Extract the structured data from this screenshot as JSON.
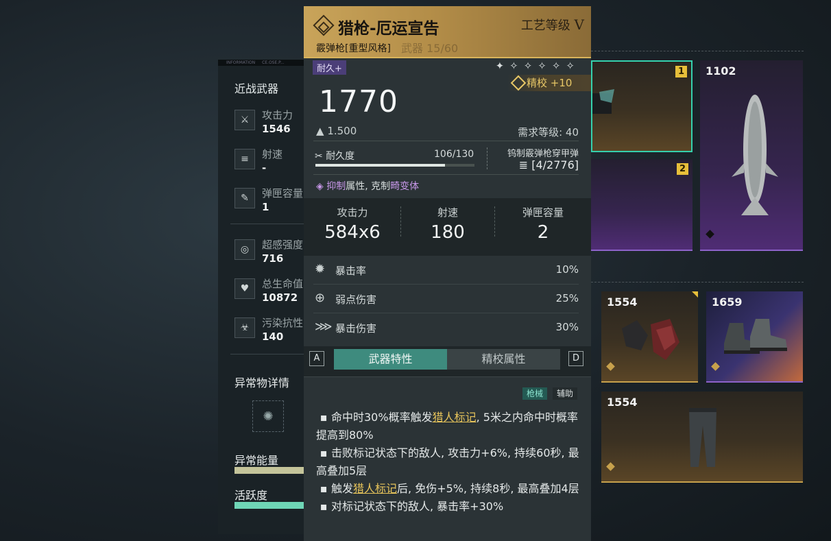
{
  "left_panel": {
    "header_tabs": [
      "INFORMATION",
      "CE.OSE.P..."
    ],
    "section_title": "近战武器",
    "stats": [
      {
        "label": "攻击力",
        "value": "1546",
        "icon": "sword-icon"
      },
      {
        "label": "射速",
        "value": "-",
        "icon": "speed-icon"
      },
      {
        "label": "弹匣容量",
        "value": "1",
        "icon": "magazine-icon"
      },
      {
        "label": "超感强度",
        "value": "716",
        "icon": "psi-icon"
      },
      {
        "label": "总生命值",
        "value": "10872",
        "icon": "heart-icon"
      },
      {
        "label": "污染抗性",
        "value": "140",
        "icon": "biohazard-icon"
      }
    ],
    "anomaly_title": "异常物详情",
    "energy_label": "异常能量",
    "activity_label": "活跃度",
    "energy_color": "#c4c49a",
    "activity_color": "#6fd6b6"
  },
  "inventory": {
    "slots": [
      {
        "number": "",
        "badge": "1",
        "rarity": "gold",
        "selected": true
      },
      {
        "number": "1102",
        "item": "fish",
        "rarity": "purple"
      },
      {
        "number": "",
        "badge": "2",
        "rarity": "purple"
      },
      {
        "number": "1554",
        "item": "gloves",
        "rarity": "gold"
      },
      {
        "number": "1659",
        "item": "boots",
        "rarity": "purple"
      },
      {
        "number": "1554",
        "item": "pants",
        "rarity": "gold"
      }
    ]
  },
  "tooltip": {
    "title": "猎枪-厄运宣告",
    "craft_label": "工艺等级",
    "craft_level": "V",
    "weapon_type": "霰弹枪[重型风格]",
    "type_ghost": "武器 15/60",
    "durable_tag": "耐久+",
    "stars": "✦✧✧✧✧✧",
    "refine": "精校 +10",
    "power": "1770",
    "weight": "1.500",
    "requirement": "需求等级: 40",
    "durability_label": "耐久度",
    "durability_value": "106/130",
    "durability_fraction": 0.815,
    "ammo_label": "钨制霰弹枪穿甲弹",
    "ammo_value": "[4/2776]",
    "trait_prefix": "抑制",
    "trait_mid": "属性, 克制",
    "trait_suffix": "畸变体",
    "stats3": [
      {
        "label": "攻击力",
        "value": "584x6"
      },
      {
        "label": "射速",
        "value": "180"
      },
      {
        "label": "弹匣容量",
        "value": "2"
      }
    ],
    "crit": [
      {
        "label": "暴击率",
        "value": "10%",
        "icon": "burst-icon"
      },
      {
        "label": "弱点伤害",
        "value": "25%",
        "icon": "target-icon"
      },
      {
        "label": "暴击伤害",
        "value": "30%",
        "icon": "claw-icon"
      }
    ],
    "key_left": "A",
    "key_right": "D",
    "tab_active": "武器特性",
    "tab_inactive": "精校属性",
    "chip_1": "枪械",
    "chip_2": "辅助",
    "desc": [
      {
        "pre": "命中时30%概率触发",
        "link": "猎人标记",
        "post": ", 5米之内命中时概率提高到80%"
      },
      {
        "pre": "击败标记状态下的敌人, 攻击力+6%, 持续60秒, 最高叠加5层",
        "link": "",
        "post": ""
      },
      {
        "pre": "触发",
        "link": "猎人标记",
        "post": "后, 免伤+5%, 持续8秒, 最高叠加4层"
      },
      {
        "pre": "对标记状态下的敌人, 暴击率+30%",
        "link": "",
        "post": ""
      }
    ]
  }
}
